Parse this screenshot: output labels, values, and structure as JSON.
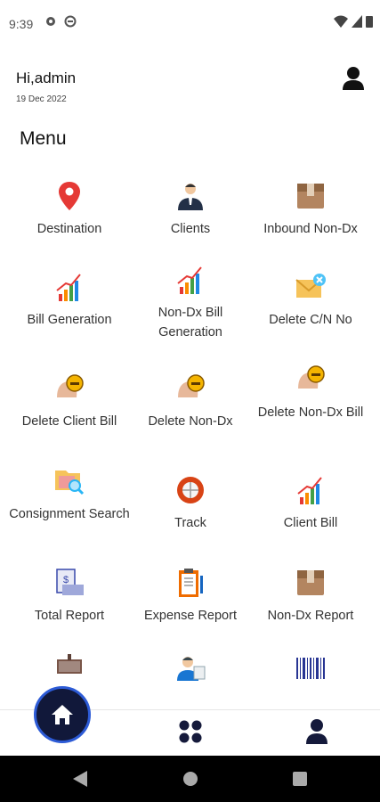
{
  "status": {
    "time": "9:39"
  },
  "header": {
    "greeting": "Hi,admin",
    "date": "19 Dec 2022"
  },
  "menu": {
    "title": "Menu",
    "items": [
      {
        "label": "Destination",
        "icon": "map-pin-icon"
      },
      {
        "label": "Clients",
        "icon": "businessman-icon"
      },
      {
        "label": "Inbound Non-Dx",
        "icon": "box-icon"
      },
      {
        "label": "Bill Generation",
        "icon": "growth-chart-icon"
      },
      {
        "label": "Non-Dx Bill Generation",
        "icon": "growth-chart-icon"
      },
      {
        "label": "Delete C/N No",
        "icon": "envelope-delete-icon"
      },
      {
        "label": "Delete Client Bill",
        "icon": "delete-person-icon"
      },
      {
        "label": "Delete Non-Dx",
        "icon": "delete-person-icon"
      },
      {
        "label": "Delete Non-Dx Bill",
        "icon": "delete-person-icon"
      },
      {
        "label": "Consignment Search",
        "icon": "folder-search-icon"
      },
      {
        "label": "Track",
        "icon": "globe-track-icon"
      },
      {
        "label": "Client Bill",
        "icon": "growth-chart-icon"
      },
      {
        "label": "Total Report",
        "icon": "invoice-report-icon"
      },
      {
        "label": "Expense Report",
        "icon": "clipboard-report-icon"
      },
      {
        "label": "Non-Dx Report",
        "icon": "box-icon"
      },
      {
        "label": "",
        "icon": "signboard-icon"
      },
      {
        "label": "",
        "icon": "employee-icon"
      },
      {
        "label": "",
        "icon": "barcode-icon"
      }
    ]
  },
  "bottom_nav": {
    "home": "home-icon",
    "grid": "grid-icon",
    "profile": "profile-icon"
  },
  "colors": {
    "fab": "#11183a",
    "fab_ring": "#2d5bd6",
    "icon_dark": "#151a3b"
  }
}
